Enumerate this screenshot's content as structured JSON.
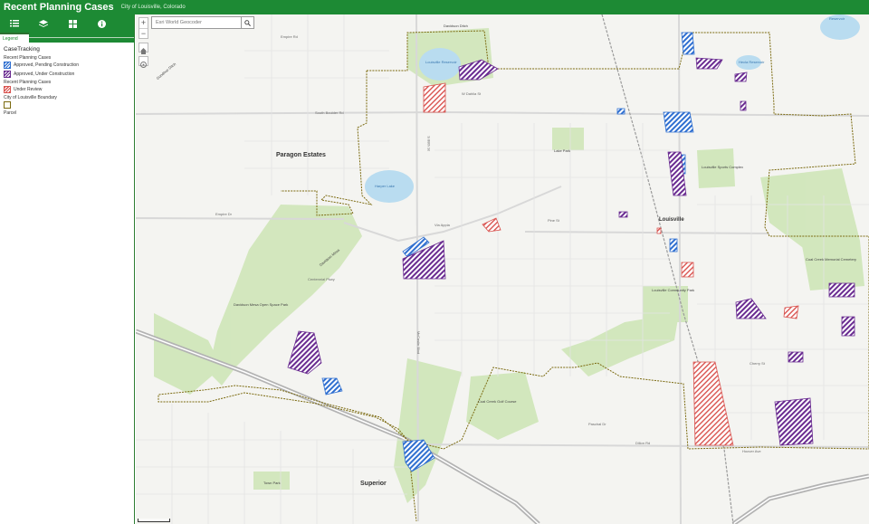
{
  "header": {
    "title": "Recent Planning Cases",
    "subtitle": "City of Louisville, Colorado"
  },
  "toolbar": {
    "tools": [
      "list-icon",
      "layers-icon",
      "basemap-grid-icon",
      "info-icon"
    ]
  },
  "panel": {
    "tab_label": "Legend"
  },
  "legend": {
    "layer_title": "CaseTracking",
    "group1": "Recent Planning Cases",
    "item1": "Approved, Pending Construction",
    "item2": "Approved, Under Construction",
    "group2": "Recent Planning Cases",
    "item3": "Under Review",
    "boundary_title": "City of Louisville Boundary",
    "parcel_title": "Parcel"
  },
  "colors": {
    "header": "#1d8a34",
    "pending": "#2f6fd0",
    "under_construction": "#6a2c91",
    "under_review": "#d9534f",
    "boundary": "#7b6a10",
    "park": "#cfe6b8",
    "water": "#b9dcf0"
  },
  "search": {
    "placeholder": "Esri World Geocoder"
  },
  "map": {
    "place_labels": [
      {
        "text": "Paragon Estates",
        "kind": "big"
      },
      {
        "text": "Superior",
        "kind": "big"
      },
      {
        "text": "Louisville",
        "kind": "big"
      },
      {
        "text": "Harper Lake",
        "kind": "water"
      },
      {
        "text": "Louisville Reservoir",
        "kind": "water"
      },
      {
        "text": "Hecla Reservoir",
        "kind": "water"
      },
      {
        "text": "Reservoir",
        "kind": "water"
      },
      {
        "text": "Davidson Mesa Open Space Park",
        "kind": "med"
      },
      {
        "text": "Louisville Sports Complex",
        "kind": "med"
      },
      {
        "text": "Coal Creek Golf Course",
        "kind": "med"
      },
      {
        "text": "Coal Creek Memorial Cemetery",
        "kind": "med"
      },
      {
        "text": "Louisville Community Park",
        "kind": "med"
      },
      {
        "text": "Town Park",
        "kind": "med"
      },
      {
        "text": "Lake Park",
        "kind": "med"
      },
      {
        "text": "Davidson Ditch",
        "kind": "med"
      },
      {
        "text": "Goodhue Ditch",
        "kind": "med"
      },
      {
        "text": "Davidson Mesa",
        "kind": "med"
      },
      {
        "text": "Centennial Pkwy",
        "kind": "road"
      },
      {
        "text": "Empire Dr",
        "kind": "road"
      },
      {
        "text": "Empire Rd",
        "kind": "road"
      },
      {
        "text": "Via Appia",
        "kind": "road"
      },
      {
        "text": "S 88th St",
        "kind": "road"
      },
      {
        "text": "McCaslin Blvd",
        "kind": "road"
      },
      {
        "text": "Dillon Rd",
        "kind": "road"
      },
      {
        "text": "South Boulder Rd",
        "kind": "road"
      },
      {
        "text": "W Dahlia St",
        "kind": "road"
      },
      {
        "text": "Paschal Dr",
        "kind": "road"
      },
      {
        "text": "Pine St",
        "kind": "road"
      },
      {
        "text": "Cherry St",
        "kind": "road"
      },
      {
        "text": "Hoover Ave",
        "kind": "road"
      }
    ]
  }
}
